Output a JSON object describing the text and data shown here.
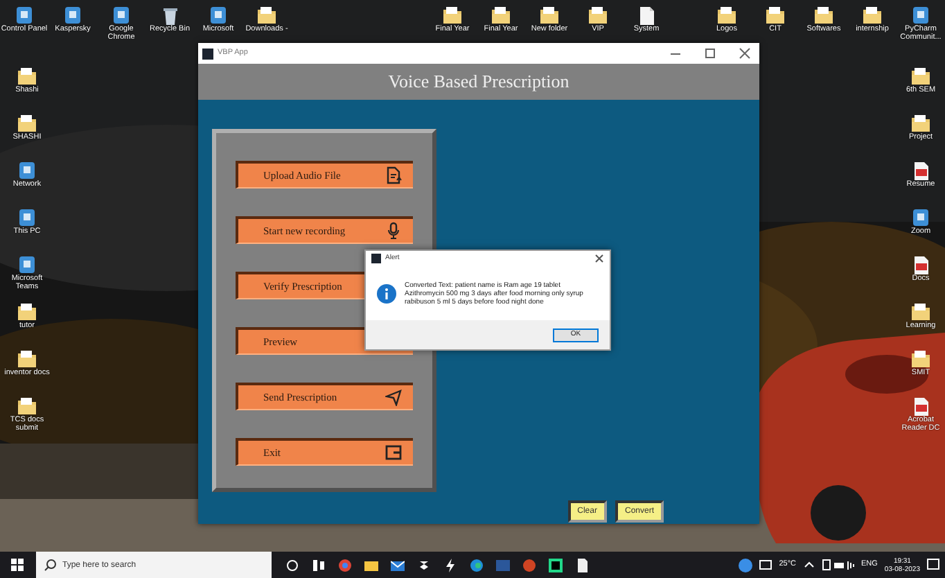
{
  "desktop": {
    "kind": "picture",
    "top_icons_left": [
      {
        "label": "Control Panel",
        "kind": "app"
      },
      {
        "label": "Kaspersky",
        "kind": "app"
      },
      {
        "label": "Google Chrome",
        "kind": "app"
      },
      {
        "label": "Recycle Bin",
        "kind": "bin"
      },
      {
        "label": "Microsoft",
        "kind": "app"
      },
      {
        "label": "Downloads -",
        "kind": "folder"
      }
    ],
    "top_icons_middle": [
      {
        "label": "Final Year",
        "kind": "folder"
      },
      {
        "label": "Final Year",
        "kind": "folder"
      },
      {
        "label": "New folder",
        "kind": "folder"
      },
      {
        "label": "VIP",
        "kind": "folder"
      },
      {
        "label": "System",
        "kind": "document"
      }
    ],
    "top_icons_right": [
      {
        "label": "Logos",
        "kind": "folder"
      },
      {
        "label": "CIT",
        "kind": "folder"
      },
      {
        "label": "Softwares",
        "kind": "folder"
      },
      {
        "label": "internship",
        "kind": "folder"
      },
      {
        "label": "PyCharm Communit...",
        "kind": "app"
      }
    ],
    "left_icons": [
      {
        "label": "Shashi",
        "kind": "folder"
      },
      {
        "label": "SHASHI",
        "kind": "folder"
      },
      {
        "label": "Network",
        "kind": "app"
      },
      {
        "label": "This PC",
        "kind": "app"
      },
      {
        "label": "Microsoft Teams",
        "kind": "app"
      },
      {
        "label": "tutor",
        "kind": "folder"
      },
      {
        "label": "inventor docs",
        "kind": "folder"
      },
      {
        "label": "TCS docs submit",
        "kind": "folder"
      }
    ],
    "right_icons": [
      {
        "label": "6th SEM",
        "kind": "folder"
      },
      {
        "label": "Project",
        "kind": "folder"
      },
      {
        "label": "Resume",
        "kind": "pdf"
      },
      {
        "label": "Zoom",
        "kind": "app"
      },
      {
        "label": "Docs",
        "kind": "pdf"
      },
      {
        "label": "Learning",
        "kind": "folder"
      },
      {
        "label": "SMIT",
        "kind": "folder"
      },
      {
        "label": "Acrobat Reader DC",
        "kind": "pdf"
      }
    ]
  },
  "window": {
    "title": "VBP App",
    "header": "Voice Based Prescription",
    "menu_buttons": [
      {
        "label": "Upload Audio File",
        "kind": "upload"
      },
      {
        "label": "Start new recording",
        "kind": "mic"
      },
      {
        "label": "Verify Prescription",
        "kind": "plain"
      },
      {
        "label": "Preview",
        "kind": "plain"
      },
      {
        "label": "Send Prescription",
        "kind": "send"
      },
      {
        "label": "Exit",
        "kind": "exit"
      }
    ],
    "bottom_buttons": [
      "Clear",
      "Convert"
    ]
  },
  "dialog": {
    "title": "Alert",
    "message": "Converted Text: patient name is Ram age 19 tablet Azithromycin 500 mg 3 days after food morning only syrup rabibuson 5 ml 5 days before food night done",
    "button": "OK"
  },
  "taskbar": {
    "search": {
      "placeholder": "Type here to search"
    },
    "weather": "25°C",
    "language": "ENG",
    "time": "19:31",
    "date": "03-08-2023"
  }
}
